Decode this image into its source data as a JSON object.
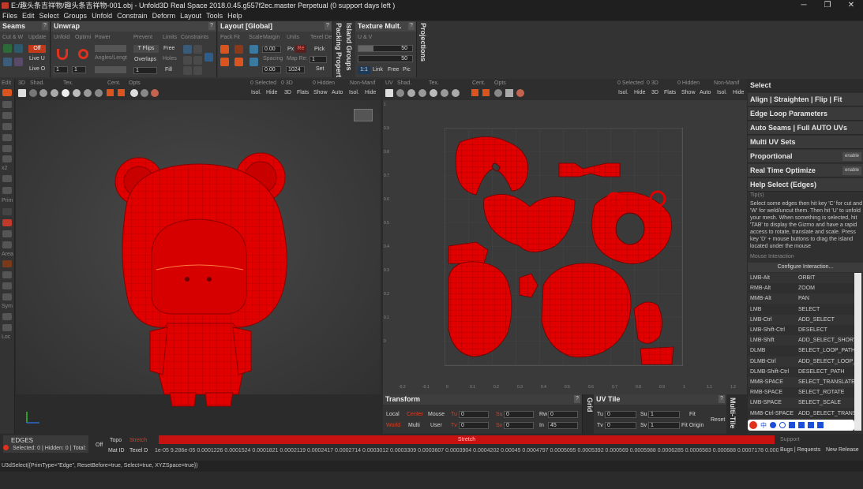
{
  "window": {
    "title": "E:/趣头条吉祥物/趣头条吉祥物-001.obj - Unfold3D  Real Space 2018.0.45.g557f2ec.master Perpetual  (0 support days left )",
    "minimize": "─",
    "maximize": "❐",
    "close": "✕"
  },
  "menu": [
    "Files",
    "Edit",
    "Select",
    "Groups",
    "Unfold",
    "Constrain",
    "Deform",
    "Layout",
    "Tools",
    "Help"
  ],
  "seams": {
    "title": "Seams",
    "help": "?",
    "cut_weld": "Cut & W",
    "update": "Update",
    "off": "Off",
    "live_u": "Live U",
    "live_o": "Live O"
  },
  "unwrap": {
    "title": "Unwrap",
    "help": "?",
    "unfold": "Unfold",
    "optimi": "Optimi",
    "power": "Power",
    "prevent": "Prevent",
    "limits": "Limits",
    "constraints": "Constraints",
    "t_flips": "T Flips",
    "free": "Free",
    "angles": "Angles/Lengt",
    "overlaps": "Overlaps",
    "holes": "Holes",
    "fill": "Fill",
    "val1": "1",
    "val2": "1",
    "val3": "1"
  },
  "layout": {
    "title": "Layout [Global]",
    "help": "?",
    "pack": "Pack",
    "fit": "Fit",
    "scale": "Scale",
    "margin": "Margin",
    "units": "Units",
    "texel": "Texel De",
    "margin_val": "0.00",
    "px": "Px",
    "re": "Re",
    "pick": "Pick",
    "spacing": "Spacing",
    "map_res": "Map Re:",
    "spacing_val": "0.00",
    "map_val": "1024",
    "texel_val": "1",
    "set": "Set"
  },
  "island_groups": "Island Groups",
  "packing": "Packing Propert",
  "texture_mult": {
    "title": "Texture Mult.",
    "help": "?",
    "uv": "U & V",
    "v1": "50",
    "v2": "50",
    "r1": "1:1",
    "link": "Link",
    "free": "Free",
    "pic": "Pic"
  },
  "projections": "Projections",
  "left_tools": [
    "Edit",
    "x2",
    "Prim",
    "Area",
    "Sym",
    "Loc"
  ],
  "vp3d": {
    "top": [
      "3D",
      "Shad.",
      "Tex.",
      "Cent.",
      "Opts",
      "0 Selected",
      "0  3D",
      "0 Hidden",
      "Non-Manif"
    ],
    "bottom": [
      "Isol.",
      "Hide",
      "3D",
      "Flats",
      "Show",
      "Auto",
      "Isol.",
      "Hide"
    ]
  },
  "vpuv": {
    "top": [
      "UV",
      "Shad.",
      "Tex.",
      "Cent.",
      "Opts",
      "0 Selected",
      "0  3D",
      "0 Hidden",
      "Non-Manif"
    ],
    "bottom": [
      "Isol.",
      "Hide",
      "3D",
      "Flats",
      "Show",
      "Auto",
      "Isol.",
      "Hide"
    ],
    "yticks": [
      "1",
      "0.9",
      "0.8",
      "0.7",
      "0.6",
      "0.5",
      "0.4",
      "0.3",
      "0.2",
      "0.1",
      "0"
    ],
    "xticks": [
      "-0.2",
      "-0.1",
      "0",
      "0.1",
      "0.2",
      "0.3",
      "0.4",
      "0.5",
      "0.6",
      "0.7",
      "0.8",
      "0.9",
      "1",
      "1.1",
      "1.2"
    ]
  },
  "right": {
    "select": "Select",
    "items": [
      "Align | Straighten | Flip | Fit",
      "Edge Loop Parameters",
      "Auto Seams | Full AUTO UVs",
      "Multi UV Sets",
      "Proportional",
      "Real Time Optimize",
      "Help Select (Edges)"
    ],
    "enable": "enable",
    "tips_label": "Tip(s)",
    "tips": "Select some edges then hit key 'C' for cut and 'W' for weld/uncut them. Then hit 'U' to unfold your mesh. When something is selected, hit 'TAB' to display the Gizmo and have a rapid access to rotate, translate and scale. Press key 'D' + mouse buttons to drag the island located under the mouse",
    "mouse_label": "Mouse Interaction",
    "configure": "Configure Interaction...",
    "bindings": [
      [
        "LMB-Alt",
        "ORBIT"
      ],
      [
        "RMB-Alt",
        "ZOOM"
      ],
      [
        "MMB-Alt",
        "PAN"
      ],
      [
        "LMB",
        "SELECT"
      ],
      [
        "LMB-Ctrl",
        "ADD_SELECT"
      ],
      [
        "LMB-Shift-Ctrl",
        "DESELECT"
      ],
      [
        "LMB-Shift",
        "ADD_SELECT_SHORT"
      ],
      [
        "DLMB",
        "SELECT_LOOP_PATH"
      ],
      [
        "DLMB-Ctrl",
        "ADD_SELECT_LOOP_P"
      ],
      [
        "DLMB-Shift-Ctrl",
        "DESELECT_PATH"
      ],
      [
        "MMB-SPACE",
        "SELECT_TRANSLATE"
      ],
      [
        "RMB-SPACE",
        "SELECT_ROTATE"
      ],
      [
        "LMB-SPACE",
        "SELECT_SCALE"
      ],
      [
        "MMB-Ctrl-SPACE",
        "ADD_SELECT_TRANS"
      ]
    ]
  },
  "transform": {
    "title": "Transform",
    "help": "?",
    "local": "Local",
    "center": "Center",
    "mouse": "Mouse",
    "tu": "Tu",
    "su": "Su",
    "rw": "Rw",
    "world": "World",
    "multi": "Multi",
    "user": "User",
    "tv": "Tv",
    "sv": "Sv",
    "in": "In",
    "v0": "0",
    "in_val": "45"
  },
  "grid": "Grid",
  "uvtile": {
    "title": "UV Tile",
    "help": "?",
    "tu": "Tu",
    "su": "Su",
    "tv": "Tv",
    "sv": "Sv",
    "tu_val": "0",
    "su_val": "1",
    "tv_val": "0",
    "sv_val": "1",
    "fit": "Fit",
    "fit_origin": "Fit Origin",
    "reset": "Reset"
  },
  "multitile": "Multi-Tile",
  "status": {
    "mode": "EDGES",
    "selected": "Selected: 0 | Hidden: 0 | Total:",
    "off": "Off",
    "topo": "Topo",
    "stretch_btn": "Stretch",
    "matid": "Mat ID",
    "texeld": "Texel D",
    "stretch_bar": "Stretch",
    "scale": "1e-05  9.286e-05 0.0001226 0.0001524 0.0001821 0.0002119 0.0002417 0.0002714 0.0003012 0.0003309 0.0003607 0.0003904 0.0004202   0.00045   0.0004797 0.0005095 0.0005392  0.000569  0.0005988 0.0006285 0.0006583  0.000688  0.0007178 0.0007·",
    "support": "Support",
    "bugs": "Bugs | Requests",
    "release": "New Release",
    "command": "U3dSelect({PrimType=\"Edge\", ResetBefore=true, Select=true, XYZSpace=true})"
  },
  "colors": {
    "accent": "#e0301e",
    "mesh": "#e00000",
    "panel": "#3a3a3a"
  }
}
